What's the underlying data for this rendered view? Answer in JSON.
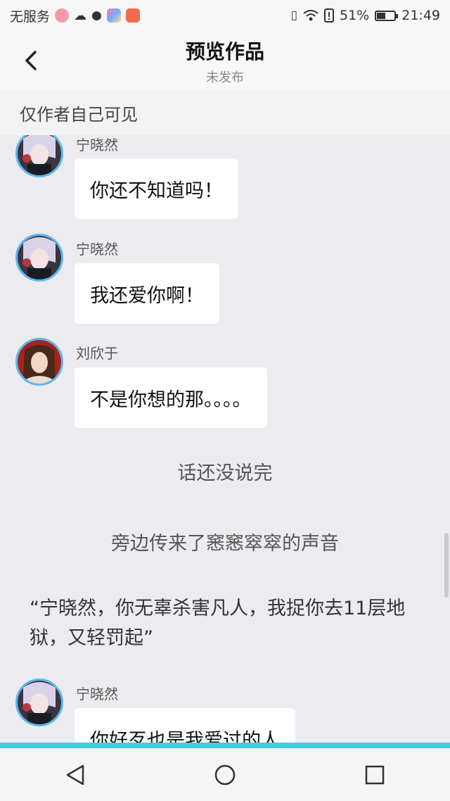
{
  "status_bar": {
    "carrier": "无服务",
    "battery": "51%",
    "battery_level": 0.51,
    "time": "21:49"
  },
  "header": {
    "title": "预览作品",
    "subtitle": "未发布"
  },
  "notice": "仅作者自己可见",
  "messages": [
    {
      "name": "宁晓然",
      "text": "你还不知道吗！"
    },
    {
      "name": "宁晓然",
      "text": "我还爱你啊！"
    },
    {
      "name": "刘欣于",
      "text": "不是你想的那。。。。"
    },
    {
      "name": "宁晓然",
      "text": "你好歹也是我爱过的人"
    }
  ],
  "narration": [
    "话还没说完",
    "旁边传来了窸窸窣窣的声音"
  ],
  "speech": "“宁晓然，你无辜杀害凡人，我捉你去11层地狱，又轻罚起”",
  "colors": {
    "accent": "#46cbe0",
    "avatar_ring": "#5ab7f2"
  }
}
